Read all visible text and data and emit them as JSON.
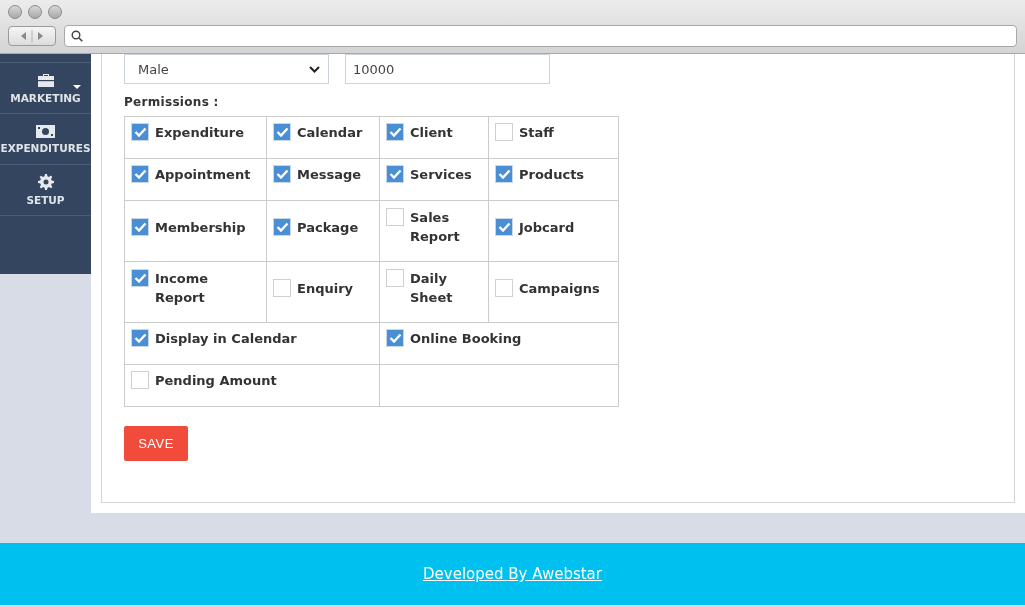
{
  "sidebar": {
    "items": [
      {
        "label": "MARKETING",
        "kind": "briefcase",
        "has_caret": true
      },
      {
        "label": "EXPENDITURES",
        "kind": "cash",
        "has_caret": false
      },
      {
        "label": "SETUP",
        "kind": "gear",
        "has_caret": false
      }
    ]
  },
  "form": {
    "gender": {
      "value": "Male"
    },
    "amount": {
      "value": "10000"
    },
    "permissions_label": "Permissions :",
    "permissions": [
      [
        {
          "label": "Expenditure",
          "checked": true
        },
        {
          "label": "Calendar",
          "checked": true
        },
        {
          "label": "Client",
          "checked": true
        },
        {
          "label": "Staff",
          "checked": false
        }
      ],
      [
        {
          "label": "Appointment",
          "checked": true
        },
        {
          "label": "Message",
          "checked": true
        },
        {
          "label": "Services",
          "checked": true
        },
        {
          "label": "Products",
          "checked": true
        }
      ],
      [
        {
          "label": "Membership",
          "checked": true
        },
        {
          "label": "Package",
          "checked": true
        },
        {
          "label": "Sales Report",
          "checked": false
        },
        {
          "label": "Jobcard",
          "checked": true
        }
      ],
      [
        {
          "label": "Income Report",
          "checked": true
        },
        {
          "label": "Enquiry",
          "checked": false
        },
        {
          "label": "Daily Sheet",
          "checked": false
        },
        {
          "label": "Campaigns",
          "checked": false
        }
      ],
      [
        {
          "label": "Display in Calendar",
          "checked": true
        },
        {
          "label": "Online Booking",
          "checked": true
        }
      ],
      [
        {
          "label": "Pending Amount",
          "checked": false
        }
      ]
    ],
    "save_button": "SAVE"
  },
  "footer": {
    "link": "Developed By Awebstar"
  }
}
